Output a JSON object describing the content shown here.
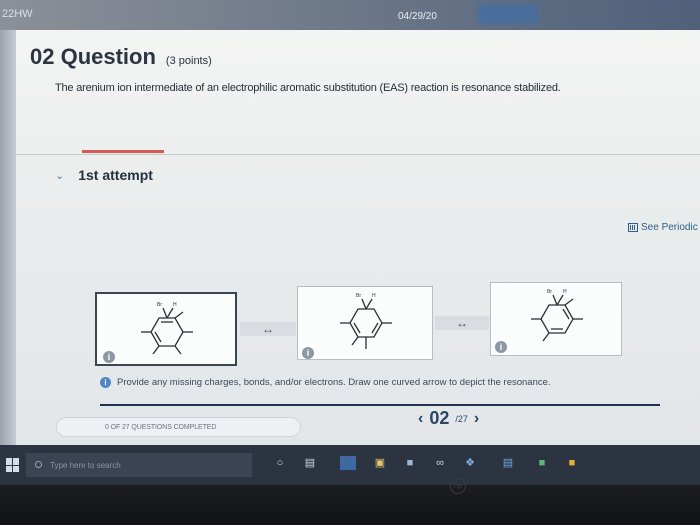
{
  "top_bar": {
    "left_label": "22HW",
    "date": "04/29/20"
  },
  "question": {
    "number_title": "02 Question",
    "points": "(3 points)",
    "text": "The arenium ion intermediate of an electrophilic aromatic substitution (EAS) reaction is resonance stabilized."
  },
  "attempt": {
    "label": "1st attempt"
  },
  "periodic_table_link": "See Periodic",
  "structures": [
    {
      "label_top": "Br",
      "label_h": "H",
      "info": "i"
    },
    {
      "label_top": "Br",
      "label_h": "H",
      "info": "i"
    },
    {
      "label_top": "Br",
      "label_h": "H",
      "info": "i"
    }
  ],
  "resonance_arrow": "↔",
  "hint": {
    "icon": "i",
    "text": "Provide any missing charges, bonds, and/or electrons. Draw one curved arrow to depict the resonance."
  },
  "progress": {
    "text": "0 OF 27 QUESTIONS COMPLETED",
    "current": "02",
    "total": "/27"
  },
  "taskbar": {
    "search_placeholder": "Type here to search",
    "icons": [
      "cortana-icon",
      "task-view-icon",
      "edge-icon",
      "store-icon",
      "photos-icon",
      "infinity-icon",
      "dropbox-icon",
      "app-icon",
      "green-app-icon",
      "yellow-app-icon"
    ]
  }
}
